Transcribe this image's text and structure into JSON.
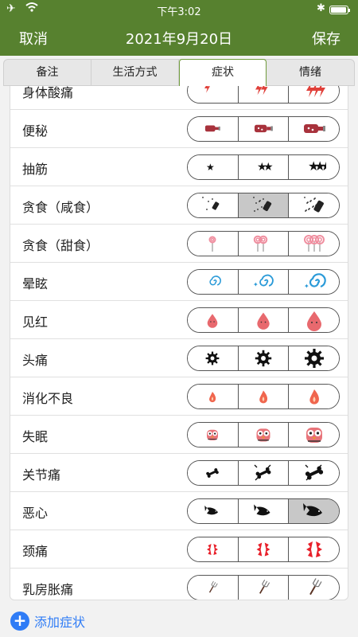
{
  "status": {
    "time": "下午3:02"
  },
  "nav": {
    "cancel": "取消",
    "title": "2021年9月20日",
    "save": "保存"
  },
  "tabs": [
    "备注",
    "生活方式",
    "症状",
    "情绪"
  ],
  "active_tab": "症状",
  "symptoms": [
    {
      "label": "身体酸痛",
      "icon": "lightning-icon",
      "color": "#e0403a",
      "selected": null
    },
    {
      "label": "便秘",
      "icon": "bottle-icon",
      "color": "#a8323c",
      "selected": null
    },
    {
      "label": "抽筋",
      "icon": "star-icon",
      "color": "#111111",
      "selected": null
    },
    {
      "label": "贪食（咸食）",
      "icon": "salt-shaker-icon",
      "color": "#222222",
      "selected": 1
    },
    {
      "label": "贪食（甜食）",
      "icon": "lollipop-icon",
      "color": "#f08fa0",
      "selected": null
    },
    {
      "label": "晕眩",
      "icon": "spiral-icon",
      "color": "#2a9ad8",
      "selected": null
    },
    {
      "label": "见红",
      "icon": "drop-icon",
      "color": "#e8696e",
      "selected": null
    },
    {
      "label": "头痛",
      "icon": "gear-icon",
      "color": "#111111",
      "selected": null
    },
    {
      "label": "消化不良",
      "icon": "flame-icon",
      "color": "#f0664e",
      "selected": null
    },
    {
      "label": "失眠",
      "icon": "owl-icon",
      "color": "#e8747a",
      "selected": null
    },
    {
      "label": "关节痛",
      "icon": "bone-icon",
      "color": "#111111",
      "selected": null
    },
    {
      "label": "恶心",
      "icon": "fish-icon",
      "color": "#111111",
      "selected": 2
    },
    {
      "label": "颈痛",
      "icon": "burst-icon",
      "color": "#e8202a",
      "selected": null
    },
    {
      "label": "乳房胀痛",
      "icon": "fork-icon",
      "color": "#5a3324",
      "selected": null
    }
  ],
  "add_symptom": "添加症状"
}
